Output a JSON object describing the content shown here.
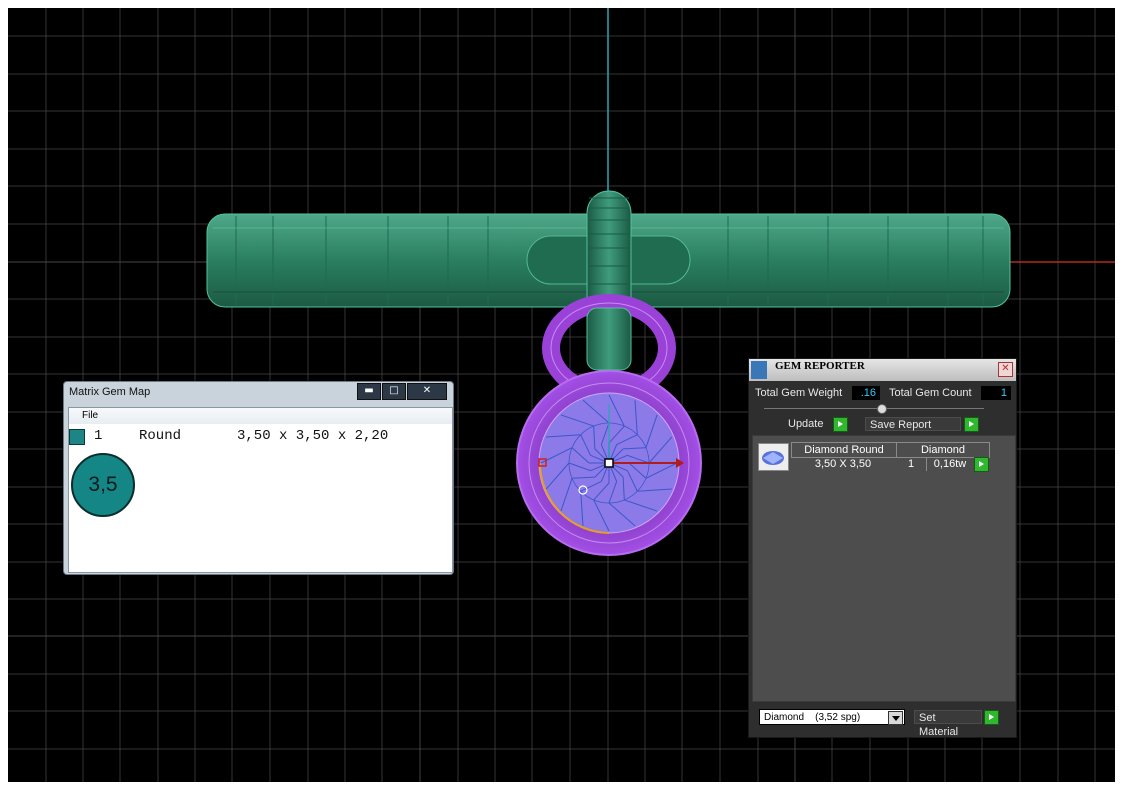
{
  "colors": {
    "viewport_bg": "#000000",
    "grid": "#4a4a4a",
    "axis_y": "#2fa6b5",
    "axis_x": "#b02c1c",
    "metal": "#2a8062",
    "head": "#a247e0",
    "gem_swatch": "#1d8585",
    "value_text": "#38c8ff",
    "green_button": "#2fb82f"
  },
  "gem_map": {
    "title": "Matrix Gem Map",
    "menu": [
      "File"
    ],
    "window_buttons": {
      "minimize": "minimize-icon",
      "maximize": "maximize-icon",
      "close": "close-icon"
    },
    "rows": [
      {
        "index": "1",
        "shape": "Round",
        "dims": "3,50 x 3,50 x 2,20",
        "color": "#1d8585"
      }
    ],
    "circle_label": "3,5"
  },
  "gem_reporter": {
    "title": "GEM REPORTER",
    "close": "close-icon",
    "total_weight_label": "Total Gem Weight",
    "total_weight_value": ".16",
    "total_count_label": "Total Gem Count",
    "total_count_value": "1",
    "update_label": "Update",
    "save_report_label": "Save Report",
    "table": {
      "header": [
        "Diamond Round",
        "Diamond"
      ],
      "rows": [
        {
          "size": "3,50 X 3,50",
          "count": "1",
          "weight": "0,16tw"
        }
      ]
    },
    "material_select": "Diamond    (3,52 spg)",
    "set_material_label": "Set Material"
  }
}
